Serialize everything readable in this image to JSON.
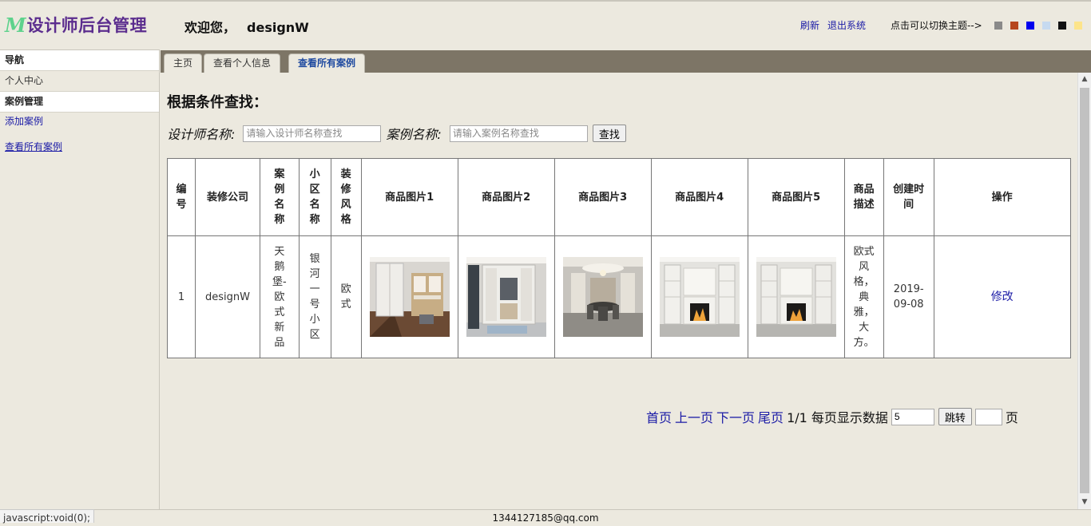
{
  "header": {
    "logo_mark": "M",
    "logo_text": "设计师后台管理",
    "welcome": "欢迎您，",
    "username": "designW",
    "refresh": "刷新",
    "logout": "退出系统",
    "theme_hint": "点击可以切换主题-->",
    "theme_colors": [
      "#8a8a8a",
      "#b6461d",
      "#0000ee",
      "#c6daf0",
      "#111111",
      "#fde48a"
    ]
  },
  "sidebar": {
    "nav_title": "导航",
    "personal": "个人中心",
    "case_title": "案例管理",
    "add_case": "添加案例",
    "view_cases": "查看所有案例"
  },
  "tabs": [
    "主页",
    "查看个人信息",
    "查看所有案例"
  ],
  "search": {
    "title": "根据条件查找：",
    "designer_label": "设计师名称:",
    "designer_placeholder": "请输入设计师名称查找",
    "case_label": "案例名称:",
    "case_placeholder": "请输入案例名称查找",
    "button": "查找"
  },
  "table": {
    "headers": [
      "编号",
      "装修公司",
      "案例名称",
      "小区名称",
      "装修风格",
      "商品图片1",
      "商品图片2",
      "商品图片3",
      "商品图片4",
      "商品图片5",
      "商品描述",
      "创建时间",
      "操作"
    ],
    "rows": [
      {
        "id": "1",
        "company": "designW",
        "case_name": "天鹅堡-欧式新品",
        "community": "银河一号小区",
        "style": "欧式",
        "description": "欧式风格，典雅，大方。",
        "created": "2019-09-08",
        "action": "修改"
      }
    ]
  },
  "pager": {
    "first": "首页",
    "prev": "上一页",
    "next": "下一页",
    "last": "尾页",
    "info": "1/1 每页显示数据",
    "page_size": "5",
    "jump": "跳转",
    "page_unit": "页"
  },
  "footer": {
    "email": "1344127185@qq.com",
    "status_url": "javascript:void(0);"
  }
}
